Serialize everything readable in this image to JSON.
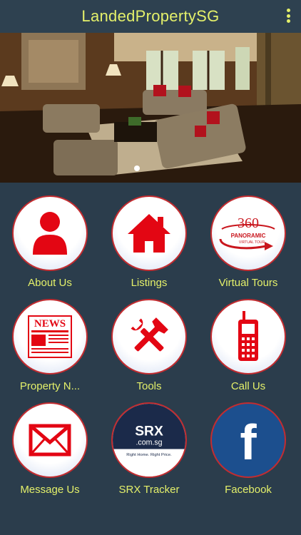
{
  "app": {
    "title": "LandedPropertySG"
  },
  "menu": {
    "icon": "more-vertical-icon"
  },
  "carousel": {
    "page_count": 1,
    "active_page": 1
  },
  "tiles": [
    {
      "label": "About Us",
      "icon": "person-icon"
    },
    {
      "label": "Listings",
      "icon": "home-icon"
    },
    {
      "label": "Virtual Tours",
      "icon": "panoramic-360-icon",
      "badge_top": "360",
      "badge_mid": "PANORAMIC",
      "badge_bot": "VIRTUAL TOUR"
    },
    {
      "label": "Property N...",
      "icon": "newspaper-icon",
      "badge_top": "NEWS"
    },
    {
      "label": "Tools",
      "icon": "tools-icon"
    },
    {
      "label": "Call Us",
      "icon": "mobile-phone-icon"
    },
    {
      "label": "Message Us",
      "icon": "envelope-icon"
    },
    {
      "label": "SRX Tracker",
      "icon": "srx-logo",
      "logo_main": "SRX",
      "logo_sub": ".com.sg",
      "logo_tag": "Right Home. Right Price."
    },
    {
      "label": "Facebook",
      "icon": "facebook-icon",
      "logo_letter": "f"
    }
  ],
  "colors": {
    "background": "#2b3d4c",
    "accent_text": "#e4f06a",
    "icon_red": "#e30613",
    "ring_red": "#c32c30",
    "facebook_blue": "#1c4f8e"
  }
}
